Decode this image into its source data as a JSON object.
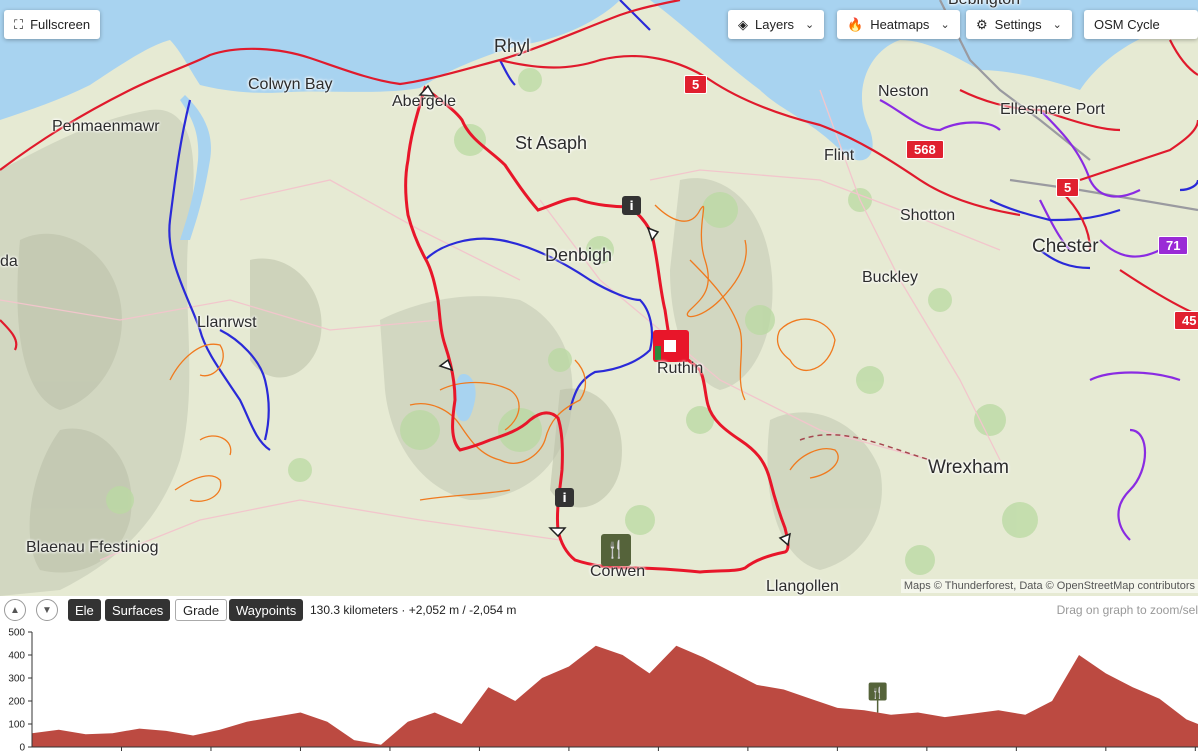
{
  "controls": {
    "fullscreen_label": "Fullscreen",
    "layers_label": "Layers",
    "heatmaps_label": "Heatmaps",
    "settings_label": "Settings",
    "basemap_label": "OSM Cycle"
  },
  "map": {
    "places": [
      {
        "name": "Rhyl",
        "size": "md"
      },
      {
        "name": "Colwyn Bay",
        "size": "sm"
      },
      {
        "name": "Abergele",
        "size": "sm"
      },
      {
        "name": "Penmaenmawr",
        "size": "sm"
      },
      {
        "name": "St Asaph",
        "size": "md"
      },
      {
        "name": "Flint",
        "size": "sm"
      },
      {
        "name": "Neston",
        "size": "sm"
      },
      {
        "name": "Bebington",
        "size": "sm"
      },
      {
        "name": "Ellesmere Port",
        "size": "sm"
      },
      {
        "name": "Shotton",
        "size": "sm"
      },
      {
        "name": "Chester",
        "size": "lg"
      },
      {
        "name": "Denbigh",
        "size": "md"
      },
      {
        "name": "Buckley",
        "size": "sm"
      },
      {
        "name": "Llanrwst",
        "size": "sm"
      },
      {
        "name": "Ruthin",
        "size": "sm"
      },
      {
        "name": "Wrexham",
        "size": "lg"
      },
      {
        "name": "Blaenau Ffestiniog",
        "size": "sm"
      },
      {
        "name": "Corwen",
        "size": "sm"
      },
      {
        "name": "Llangollen",
        "size": "sm"
      },
      {
        "name": "da",
        "size": "sm"
      }
    ],
    "shields": [
      {
        "label": "5",
        "color": "red"
      },
      {
        "label": "568",
        "color": "red"
      },
      {
        "label": "5",
        "color": "red"
      },
      {
        "label": "71",
        "color": "purple"
      },
      {
        "label": "45",
        "color": "red"
      }
    ],
    "attribution": "Maps © Thunderforest, Data © OpenStreetMap contributors",
    "colors": {
      "route": "#e8162a",
      "cycle_route_blue": "#2a2ad8",
      "cycle_route_orange": "#f07a1e",
      "cycle_route_purple": "#8a2be2",
      "sea": "#a8d3f0",
      "land": "#e6ead3",
      "elevation_fill": "#bc4a41"
    }
  },
  "elevation": {
    "collapse_up_icon": "chevron-up-icon",
    "collapse_down_icon": "chevron-down-icon",
    "tabs": [
      {
        "label": "Ele",
        "active": true
      },
      {
        "label": "Surfaces",
        "active": true
      },
      {
        "label": "Grade",
        "active": false
      },
      {
        "label": "Waypoints",
        "active": true
      }
    ],
    "stats": "130.3 kilometers · +2,052 m / -2,054 m",
    "hint": "Drag on graph to zoom/sel"
  },
  "chart_data": {
    "type": "area",
    "xlabel": "",
    "ylabel": "",
    "ylim": [
      0,
      500
    ],
    "yticks": [
      0,
      100,
      200,
      300,
      400,
      500
    ],
    "xlim": [
      0,
      130.3
    ],
    "x": [
      0,
      3,
      6,
      9,
      12,
      15,
      18,
      21,
      24,
      27,
      30,
      33,
      36,
      39,
      42,
      45,
      48,
      51,
      54,
      57,
      60,
      63,
      66,
      69,
      72,
      75,
      78,
      81,
      84,
      87,
      90,
      93,
      96,
      99,
      102,
      105,
      108,
      111,
      114,
      117,
      120,
      123,
      126,
      129,
      130.3
    ],
    "y": [
      60,
      75,
      55,
      60,
      80,
      70,
      50,
      75,
      110,
      130,
      150,
      110,
      30,
      10,
      110,
      150,
      100,
      260,
      200,
      300,
      350,
      440,
      400,
      320,
      440,
      390,
      330,
      270,
      250,
      210,
      170,
      160,
      140,
      150,
      130,
      145,
      160,
      140,
      200,
      400,
      320,
      260,
      210,
      120,
      100
    ],
    "waypoint": {
      "x": 94.5,
      "icon": "fork-knife-icon"
    }
  }
}
